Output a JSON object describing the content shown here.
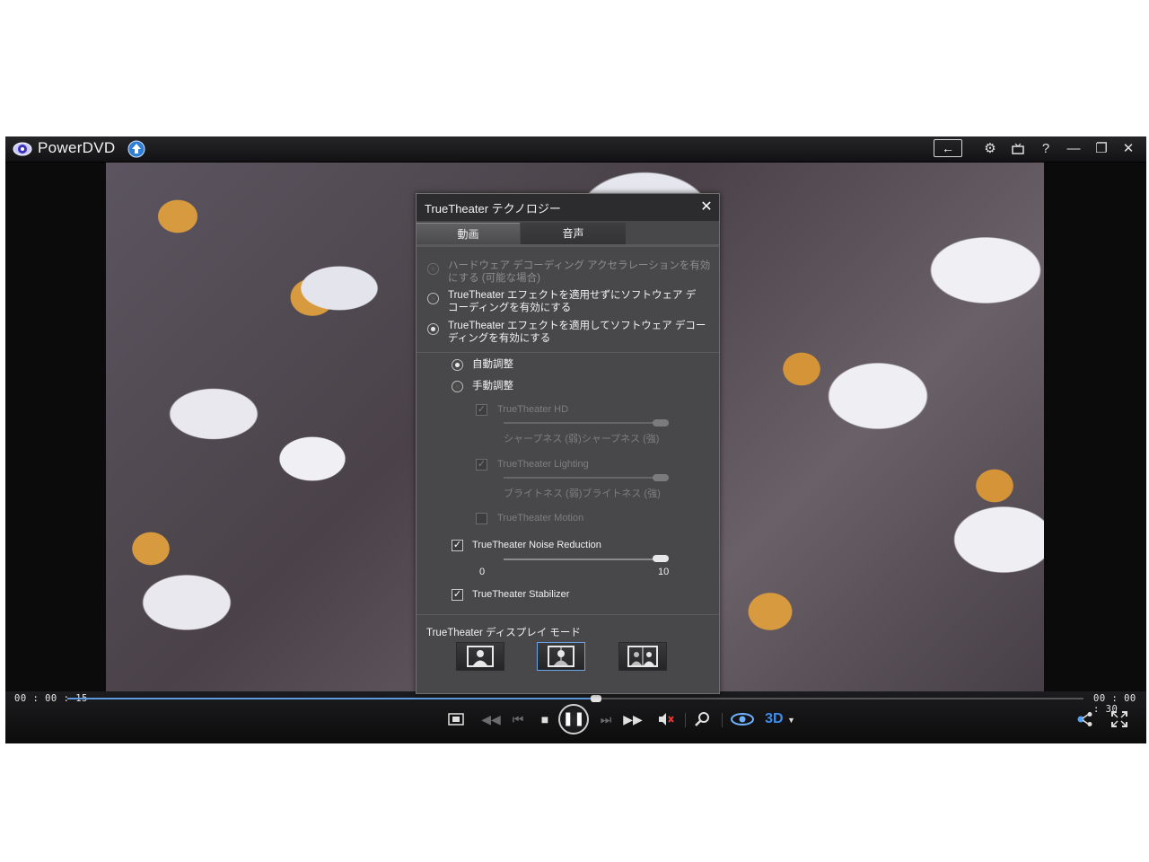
{
  "app": {
    "title": "PowerDVD"
  },
  "titlebar": {
    "back_label": "←",
    "settings_icon": "gear-icon",
    "tv_icon": "tv-mode-icon",
    "help_label": "?",
    "minimize_label": "—",
    "restore_label": "❐",
    "close_label": "✕"
  },
  "panel": {
    "title": "TrueTheater テクノロジー",
    "close_label": "✕",
    "tabs": [
      {
        "label": "動画",
        "active": true
      },
      {
        "label": "音声",
        "active": false
      }
    ],
    "decoding_options": [
      {
        "line1": "ハードウェア デコーディング アクセラレーションを有効",
        "line2": "にする (可能な場合)",
        "checked": false,
        "disabled": true
      },
      {
        "line1": "TrueTheater エフェクトを適用せずにソフトウェア デ",
        "line2": "コーディングを有効にする",
        "checked": false,
        "disabled": false
      },
      {
        "line1": "TrueTheater エフェクトを適用してソフトウェア デコー",
        "line2": "ディングを有効にする",
        "checked": true,
        "disabled": false
      }
    ],
    "adjust_mode": [
      {
        "label": "自動調整",
        "checked": true
      },
      {
        "label": "手動調整",
        "checked": false
      }
    ],
    "manual": {
      "hd_label": "TrueTheater HD",
      "hd_scale": "シャープネス (弱)シャープネス (強)",
      "lighting_label": "TrueTheater Lighting",
      "lighting_scale": "ブライトネス (弱)ブライトネス (強)",
      "motion_label": "TrueTheater Motion"
    },
    "noise_reduction": {
      "label": "TrueTheater Noise Reduction",
      "checked": true,
      "min": "0",
      "max": "10",
      "value": 10
    },
    "stabilizer": {
      "label": "TrueTheater Stabilizer",
      "checked": true
    },
    "display_mode": {
      "label": "TrueTheater ディスプレイ モード",
      "options": [
        "full-view-icon",
        "split-view-icon",
        "side-by-side-icon"
      ],
      "selected_index": 1
    }
  },
  "player": {
    "elapsed": "00 : 00 : 15",
    "total": "00 : 00 : 30",
    "progress": 0.52,
    "accent_color": "#5c9be0",
    "three_d_label": "3D"
  }
}
